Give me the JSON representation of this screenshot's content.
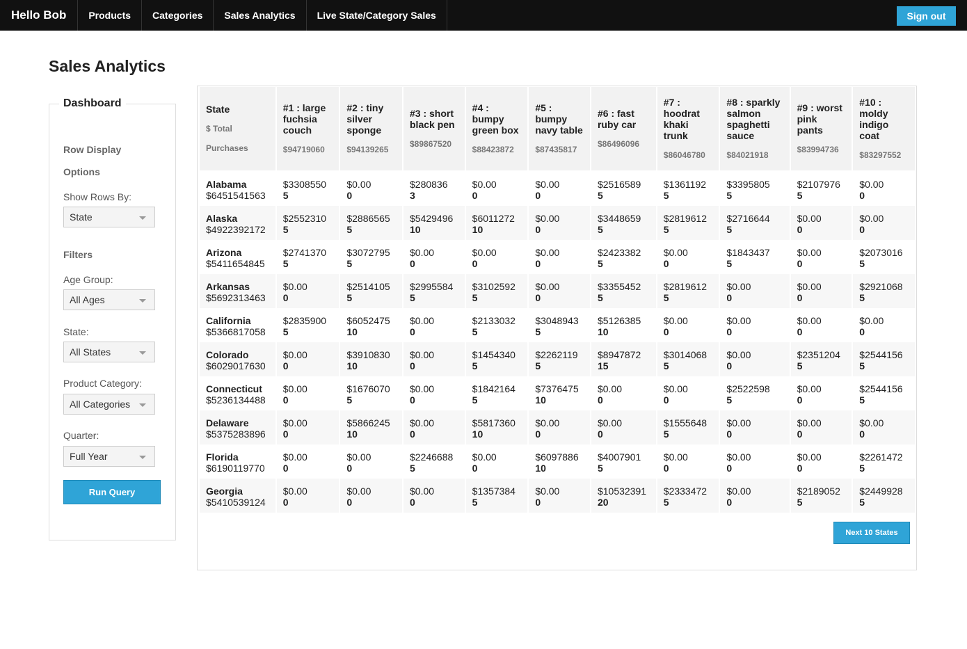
{
  "nav": {
    "brand": "Hello Bob",
    "items": [
      "Products",
      "Categories",
      "Sales Analytics",
      "Live State/Category Sales"
    ],
    "signout": "Sign out"
  },
  "page_title": "Sales Analytics",
  "sidebar": {
    "legend": "Dashboard",
    "row_display_line1": "Row Display",
    "row_display_line2": "Options",
    "show_rows_label": "Show Rows By:",
    "show_rows_value": "State",
    "filters_heading": "Filters",
    "age_label": "Age Group:",
    "age_value": "All Ages",
    "state_label": "State:",
    "state_value": "All States",
    "category_label": "Product Category:",
    "category_value": "All Categories",
    "quarter_label": "Quarter:",
    "quarter_value": "Full Year",
    "run_query": "Run Query"
  },
  "table": {
    "first_header": {
      "title": "State",
      "sub1": "$ Total",
      "sub2": "Purchases"
    },
    "columns": [
      {
        "title": "#1 : large fuchsia couch",
        "total": "$94719060"
      },
      {
        "title": "#2 : tiny silver sponge",
        "total": "$94139265"
      },
      {
        "title": "#3 : short black pen",
        "total": "$89867520"
      },
      {
        "title": "#4 : bumpy green box",
        "total": "$88423872"
      },
      {
        "title": "#5 : bumpy navy table",
        "total": "$87435817"
      },
      {
        "title": "#6 : fast ruby car",
        "total": "$86496096"
      },
      {
        "title": "#7 : hoodrat khaki trunk",
        "total": "$86046780"
      },
      {
        "title": "#8 : sparkly salmon spaghetti sauce",
        "total": "$84021918"
      },
      {
        "title": "#9 : worst pink pants",
        "total": "$83994736"
      },
      {
        "title": "#10 : moldy indigo coat",
        "total": "$83297552"
      }
    ],
    "rows": [
      {
        "state": "Alabama",
        "total": "$6451541563",
        "cells": [
          [
            "$3308550",
            "5"
          ],
          [
            "$0.00",
            "0"
          ],
          [
            "$280836",
            "3"
          ],
          [
            "$0.00",
            "0"
          ],
          [
            "$0.00",
            "0"
          ],
          [
            "$2516589",
            "5"
          ],
          [
            "$1361192",
            "5"
          ],
          [
            "$3395805",
            "5"
          ],
          [
            "$2107976",
            "5"
          ],
          [
            "$0.00",
            "0"
          ]
        ]
      },
      {
        "state": "Alaska",
        "total": "$4922392172",
        "cells": [
          [
            "$2552310",
            "5"
          ],
          [
            "$2886565",
            "5"
          ],
          [
            "$5429496",
            "10"
          ],
          [
            "$6011272",
            "10"
          ],
          [
            "$0.00",
            "0"
          ],
          [
            "$3448659",
            "5"
          ],
          [
            "$2819612",
            "5"
          ],
          [
            "$2716644",
            "5"
          ],
          [
            "$0.00",
            "0"
          ],
          [
            "$0.00",
            "0"
          ]
        ]
      },
      {
        "state": "Arizona",
        "total": "$5411654845",
        "cells": [
          [
            "$2741370",
            "5"
          ],
          [
            "$3072795",
            "5"
          ],
          [
            "$0.00",
            "0"
          ],
          [
            "$0.00",
            "0"
          ],
          [
            "$0.00",
            "0"
          ],
          [
            "$2423382",
            "5"
          ],
          [
            "$0.00",
            "0"
          ],
          [
            "$1843437",
            "5"
          ],
          [
            "$0.00",
            "0"
          ],
          [
            "$2073016",
            "5"
          ]
        ]
      },
      {
        "state": "Arkansas",
        "total": "$5692313463",
        "cells": [
          [
            "$0.00",
            "0"
          ],
          [
            "$2514105",
            "5"
          ],
          [
            "$2995584",
            "5"
          ],
          [
            "$3102592",
            "5"
          ],
          [
            "$0.00",
            "0"
          ],
          [
            "$3355452",
            "5"
          ],
          [
            "$2819612",
            "5"
          ],
          [
            "$0.00",
            "0"
          ],
          [
            "$0.00",
            "0"
          ],
          [
            "$2921068",
            "5"
          ]
        ]
      },
      {
        "state": "California",
        "total": "$5366817058",
        "cells": [
          [
            "$2835900",
            "5"
          ],
          [
            "$6052475",
            "10"
          ],
          [
            "$0.00",
            "0"
          ],
          [
            "$2133032",
            "5"
          ],
          [
            "$3048943",
            "5"
          ],
          [
            "$5126385",
            "10"
          ],
          [
            "$0.00",
            "0"
          ],
          [
            "$0.00",
            "0"
          ],
          [
            "$0.00",
            "0"
          ],
          [
            "$0.00",
            "0"
          ]
        ]
      },
      {
        "state": "Colorado",
        "total": "$6029017630",
        "cells": [
          [
            "$0.00",
            "0"
          ],
          [
            "$3910830",
            "10"
          ],
          [
            "$0.00",
            "0"
          ],
          [
            "$1454340",
            "5"
          ],
          [
            "$2262119",
            "5"
          ],
          [
            "$8947872",
            "15"
          ],
          [
            "$3014068",
            "5"
          ],
          [
            "$0.00",
            "0"
          ],
          [
            "$2351204",
            "5"
          ],
          [
            "$2544156",
            "5"
          ]
        ]
      },
      {
        "state": "Connecticut",
        "total": "$5236134488",
        "cells": [
          [
            "$0.00",
            "0"
          ],
          [
            "$1676070",
            "5"
          ],
          [
            "$0.00",
            "0"
          ],
          [
            "$1842164",
            "5"
          ],
          [
            "$7376475",
            "10"
          ],
          [
            "$0.00",
            "0"
          ],
          [
            "$0.00",
            "0"
          ],
          [
            "$2522598",
            "5"
          ],
          [
            "$0.00",
            "0"
          ],
          [
            "$2544156",
            "5"
          ]
        ]
      },
      {
        "state": "Delaware",
        "total": "$5375283896",
        "cells": [
          [
            "$0.00",
            "0"
          ],
          [
            "$5866245",
            "10"
          ],
          [
            "$0.00",
            "0"
          ],
          [
            "$5817360",
            "10"
          ],
          [
            "$0.00",
            "0"
          ],
          [
            "$0.00",
            "0"
          ],
          [
            "$1555648",
            "5"
          ],
          [
            "$0.00",
            "0"
          ],
          [
            "$0.00",
            "0"
          ],
          [
            "$0.00",
            "0"
          ]
        ]
      },
      {
        "state": "Florida",
        "total": "$6190119770",
        "cells": [
          [
            "$0.00",
            "0"
          ],
          [
            "$0.00",
            "0"
          ],
          [
            "$2246688",
            "5"
          ],
          [
            "$0.00",
            "0"
          ],
          [
            "$6097886",
            "10"
          ],
          [
            "$4007901",
            "5"
          ],
          [
            "$0.00",
            "0"
          ],
          [
            "$0.00",
            "0"
          ],
          [
            "$0.00",
            "0"
          ],
          [
            "$2261472",
            "5"
          ]
        ]
      },
      {
        "state": "Georgia",
        "total": "$5410539124",
        "cells": [
          [
            "$0.00",
            "0"
          ],
          [
            "$0.00",
            "0"
          ],
          [
            "$0.00",
            "0"
          ],
          [
            "$1357384",
            "5"
          ],
          [
            "$0.00",
            "0"
          ],
          [
            "$10532391",
            "20"
          ],
          [
            "$2333472",
            "5"
          ],
          [
            "$0.00",
            "0"
          ],
          [
            "$2189052",
            "5"
          ],
          [
            "$2449928",
            "5"
          ]
        ]
      }
    ],
    "next_button": "Next 10 States"
  }
}
